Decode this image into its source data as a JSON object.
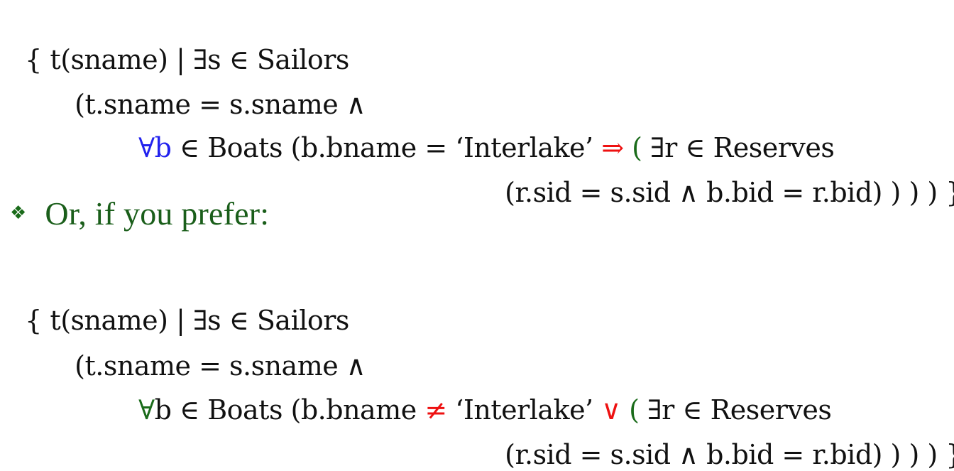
{
  "query1": {
    "line1": {
      "brace": "{ t(sname) ",
      "bar": "|",
      "exists": " ∃",
      "rest": "s ∈ Sailors"
    },
    "line2": {
      "text": "(t.sname = s.sname ∧"
    },
    "line3": {
      "forall": "∀",
      "var": "b",
      "boats": " ∈ Boats (b.bname = ‘Interlake’ ",
      "implies": "⇒",
      "paren": " ( ",
      "exists": "∃",
      "reserves": "r ∈ Reserves"
    },
    "line4": {
      "text": "(r.sid = s.sid ∧ b.bid = r.bid) ) ) ) }"
    }
  },
  "bullet": {
    "icon": "❖",
    "text": "Or, if you prefer:"
  },
  "query2": {
    "line1": {
      "brace": "{ t(sname) ",
      "bar": "|",
      "exists": " ∃",
      "rest": "s ∈ Sailors"
    },
    "line2": {
      "text": "(t.sname = s.sname ∧"
    },
    "line3": {
      "forall": "∀",
      "boats_pre": "b ∈ Boats (b.bname ",
      "neq": "≠",
      "interlake": " ‘Interlake’ ",
      "or": "∨",
      "paren": " ( ",
      "exists": "∃",
      "reserves": "r ∈ Reserves"
    },
    "line4": {
      "text": "(r.sid = s.sid ∧ b.bid = r.bid) ) ) ) }"
    }
  },
  "colors": {
    "forall_query1": "#2222ee",
    "forall_query2": "#1a6b1a",
    "operator": "#ee1111",
    "paren": "#1a6b1a",
    "bullet_text": "#1a5e1a"
  }
}
